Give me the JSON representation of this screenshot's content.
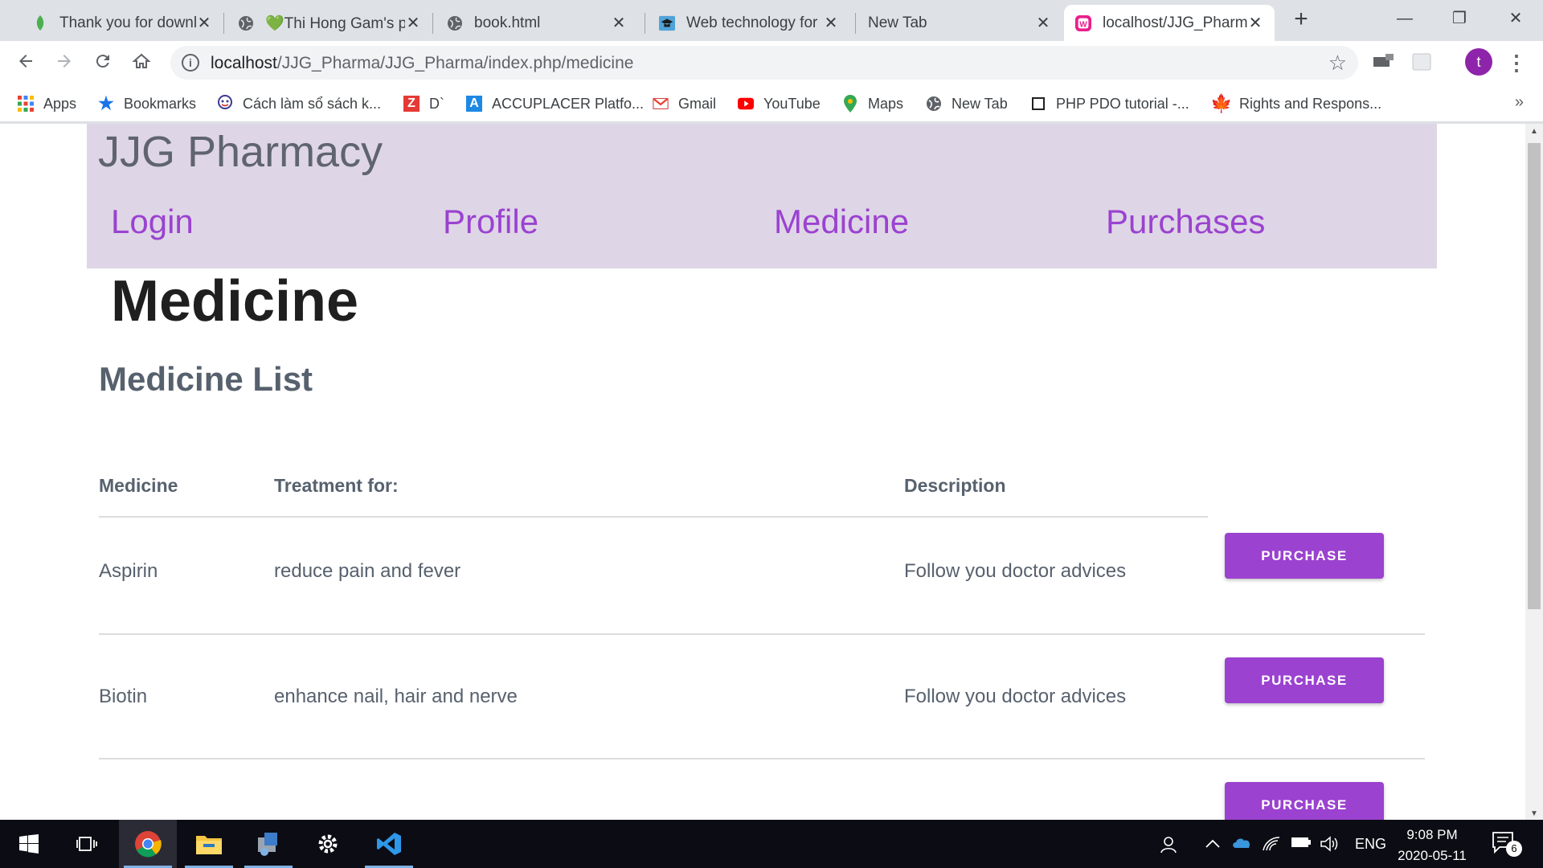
{
  "browser": {
    "tabs": [
      {
        "title": "Thank you for downl",
        "icon": "leaf-icon"
      },
      {
        "title": "💚Thi Hong Gam's p",
        "icon": "globe-icon"
      },
      {
        "title": "book.html",
        "icon": "globe-icon"
      },
      {
        "title": "Web technology for",
        "icon": "graduation-cap-icon"
      },
      {
        "title": "New Tab",
        "icon": ""
      },
      {
        "title": "localhost/JJG_Pharm",
        "icon": "wampserver-icon"
      }
    ],
    "url_host": "localhost",
    "url_path": "/JJG_Pharma/JJG_Pharma/index.php/medicine",
    "profile_initial": "t",
    "bookmarks": [
      {
        "label": "Apps",
        "icon": "apps-grid-icon"
      },
      {
        "label": "Bookmarks",
        "icon": "star-icon"
      },
      {
        "label": "Cách làm sổ sách k...",
        "icon": "mascot-icon"
      },
      {
        "label": "D`",
        "icon": "z-logo-icon"
      },
      {
        "label": "ACCUPLACER Platfo...",
        "icon": "a-logo-icon"
      },
      {
        "label": "Gmail",
        "icon": "gmail-icon"
      },
      {
        "label": "YouTube",
        "icon": "youtube-icon"
      },
      {
        "label": "Maps",
        "icon": "maps-pin-icon"
      },
      {
        "label": "New Tab",
        "icon": "globe-icon"
      },
      {
        "label": "PHP PDO tutorial -...",
        "icon": "square-icon"
      },
      {
        "label": "Rights and Respons...",
        "icon": "maple-leaf-icon"
      }
    ],
    "more_bookmarks": "»"
  },
  "site": {
    "brand": "JJG Pharmacy",
    "nav": [
      "Login",
      "Profile",
      "Medicine",
      "Purchases"
    ],
    "page_title": "Medicine",
    "list_title": "Medicine List",
    "columns": [
      "Medicine",
      "Treatment for:",
      "Description"
    ],
    "rows": [
      {
        "name": "Aspirin",
        "treatment": "reduce pain and fever",
        "description": "Follow you doctor advices"
      },
      {
        "name": "Biotin",
        "treatment": "enhance nail, hair and nerve",
        "description": "Follow you doctor advices"
      }
    ],
    "purchase_label": "PURCHASE",
    "accent_color": "#9b42d0",
    "header_bg": "#ded6e6"
  },
  "taskbar": {
    "apps": [
      "windows-start-icon",
      "task-view-icon",
      "chrome-icon",
      "file-explorer-icon",
      "network-app-icon",
      "settings-gear-icon",
      "vscode-icon"
    ],
    "language": "ENG",
    "time": "9:08 PM",
    "date": "2020-05-11",
    "notification_count": "6"
  }
}
